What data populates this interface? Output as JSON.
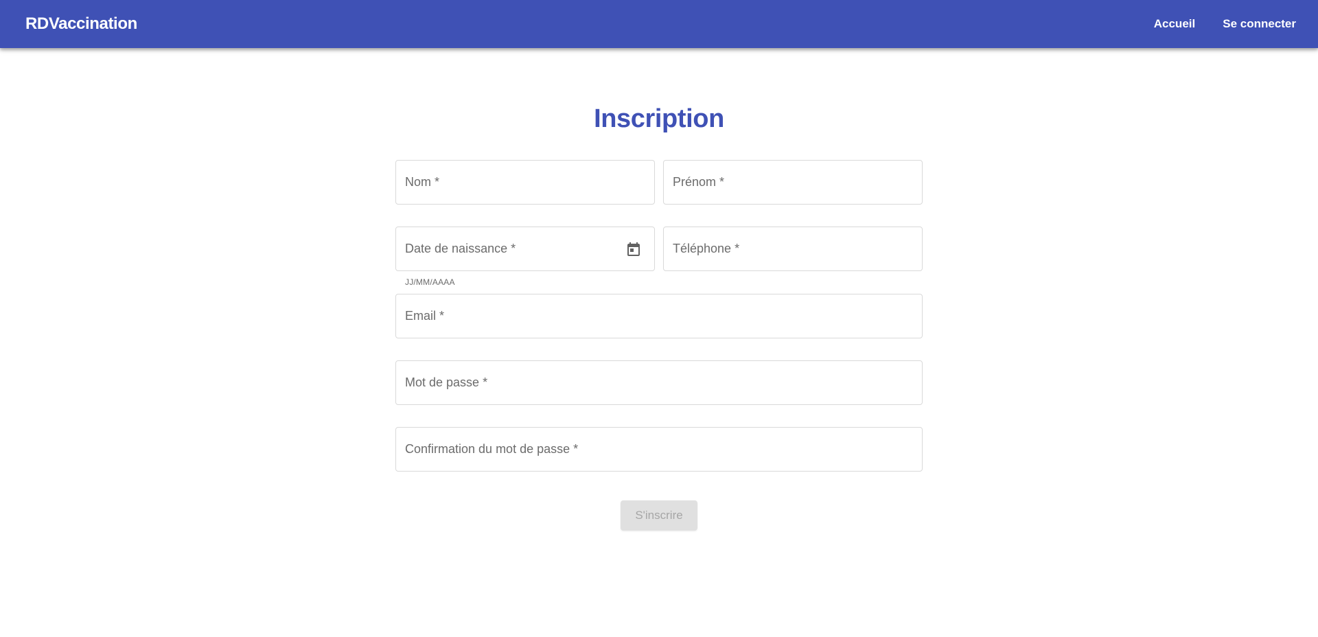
{
  "header": {
    "brand": "RDVaccination",
    "nav": [
      {
        "label": "Accueil"
      },
      {
        "label": "Se connecter"
      }
    ],
    "background_color": "#3f51b5"
  },
  "page": {
    "title": "Inscription",
    "title_color": "#3f51b5"
  },
  "form": {
    "nom": {
      "placeholder": "Nom *",
      "value": ""
    },
    "prenom": {
      "placeholder": "Prénom *",
      "value": ""
    },
    "date_naissance": {
      "placeholder": "Date de naissance *",
      "value": "",
      "hint": "JJ/MM/AAAA",
      "icon": "calendar-icon"
    },
    "telephone": {
      "placeholder": "Téléphone *",
      "value": ""
    },
    "email": {
      "placeholder": "Email *",
      "value": ""
    },
    "mot_de_passe": {
      "placeholder": "Mot de passe *",
      "value": ""
    },
    "confirmation": {
      "placeholder": "Confirmation du mot de passe *",
      "value": ""
    },
    "submit_label": "S'inscrire",
    "submit_disabled": true
  }
}
